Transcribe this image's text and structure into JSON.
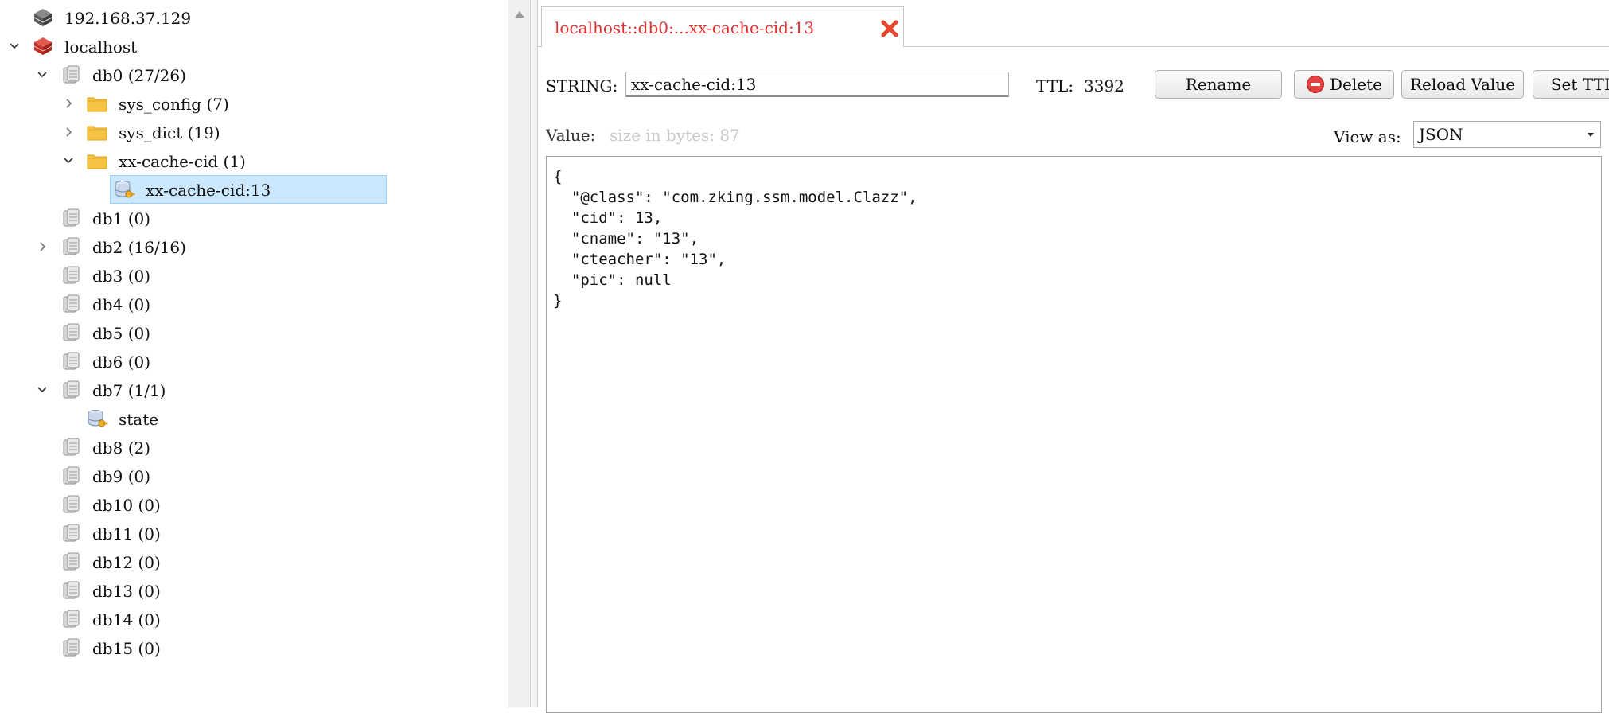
{
  "tree": {
    "items": [
      {
        "label": "192.168.37.129",
        "icon": "server-icon",
        "expanded": null
      },
      {
        "label": "localhost",
        "icon": "redis-icon",
        "expanded": true
      },
      {
        "label": "db0  (27/26)",
        "icon": "database-icon",
        "expanded": true
      },
      {
        "label": "sys_config (7)",
        "icon": "folder-icon",
        "expanded": false
      },
      {
        "label": "sys_dict (19)",
        "icon": "folder-icon",
        "expanded": false
      },
      {
        "label": "xx-cache-cid (1)",
        "icon": "folder-icon",
        "expanded": true
      },
      {
        "label": "xx-cache-cid:13",
        "icon": "key-icon",
        "selected": true
      },
      {
        "label": "db1 (0)",
        "icon": "database-icon"
      },
      {
        "label": "db2  (16/16)",
        "icon": "database-icon",
        "expanded": false
      },
      {
        "label": "db3 (0)",
        "icon": "database-icon"
      },
      {
        "label": "db4 (0)",
        "icon": "database-icon"
      },
      {
        "label": "db5 (0)",
        "icon": "database-icon"
      },
      {
        "label": "db6 (0)",
        "icon": "database-icon"
      },
      {
        "label": "db7  (1/1)",
        "icon": "database-icon",
        "expanded": true
      },
      {
        "label": "state",
        "icon": "key-icon"
      },
      {
        "label": "db8 (2)",
        "icon": "database-icon"
      },
      {
        "label": "db9 (0)",
        "icon": "database-icon"
      },
      {
        "label": "db10  (0)",
        "icon": "database-icon"
      },
      {
        "label": "db11  (0)",
        "icon": "database-icon"
      },
      {
        "label": "db12  (0)",
        "icon": "database-icon"
      },
      {
        "label": "db13  (0)",
        "icon": "database-icon"
      },
      {
        "label": "db14  (0)",
        "icon": "database-icon"
      },
      {
        "label": "db15  (0)",
        "icon": "database-icon"
      }
    ]
  },
  "tab": {
    "title": "localhost::db0:...xx-cache-cid:13",
    "close_icon": "close-icon",
    "title_color": "#e03030"
  },
  "key": {
    "type_label": "STRING:",
    "name": "xx-cache-cid:13",
    "ttl_label": "TTL:",
    "ttl_value": "3392"
  },
  "buttons": {
    "rename": "Rename",
    "delete": "Delete",
    "reload": "Reload Value",
    "set_ttl": "Set TTL"
  },
  "value": {
    "label": "Value:",
    "size_text": "size in bytes: 87",
    "view_as_label": "View as:",
    "view_as_selected": "JSON",
    "content": "{\n  \"@class\": \"com.zking.ssm.model.Clazz\",\n  \"cid\": 13,\n  \"cname\": \"13\",\n  \"cteacher\": \"13\",\n  \"pic\": null\n}"
  },
  "colors": {
    "selection_bg": "#cce8ff",
    "accent_red": "#e03030",
    "folder_yellow": "#f5c242"
  }
}
